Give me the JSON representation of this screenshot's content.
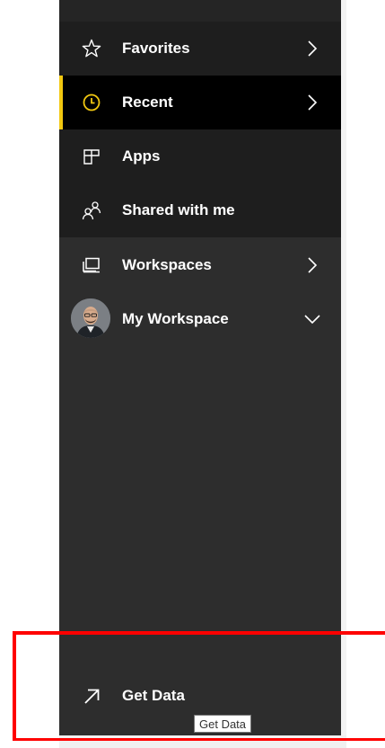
{
  "nav": {
    "items": [
      {
        "label": "Favorites",
        "icon": "star-icon",
        "has_chevron": true,
        "chevron": "right"
      },
      {
        "label": "Recent",
        "icon": "clock-icon",
        "has_chevron": true,
        "chevron": "right",
        "selected": true
      },
      {
        "label": "Apps",
        "icon": "apps-icon",
        "has_chevron": false
      },
      {
        "label": "Shared with me",
        "icon": "shared-people-icon",
        "has_chevron": false
      },
      {
        "label": "Workspaces",
        "icon": "workspaces-icon",
        "has_chevron": true,
        "chevron": "right"
      },
      {
        "label": "My Workspace",
        "icon": "user-avatar",
        "has_chevron": true,
        "chevron": "down"
      }
    ],
    "get_data": {
      "label": "Get Data",
      "icon": "arrow-up-right-icon"
    }
  },
  "tooltip": {
    "text": "Get Data"
  },
  "colors": {
    "nav_background": "#2d2d2d",
    "selected_background": "#000000",
    "selected_accent": "#f2c811",
    "annotation_red": "#ff0000"
  }
}
